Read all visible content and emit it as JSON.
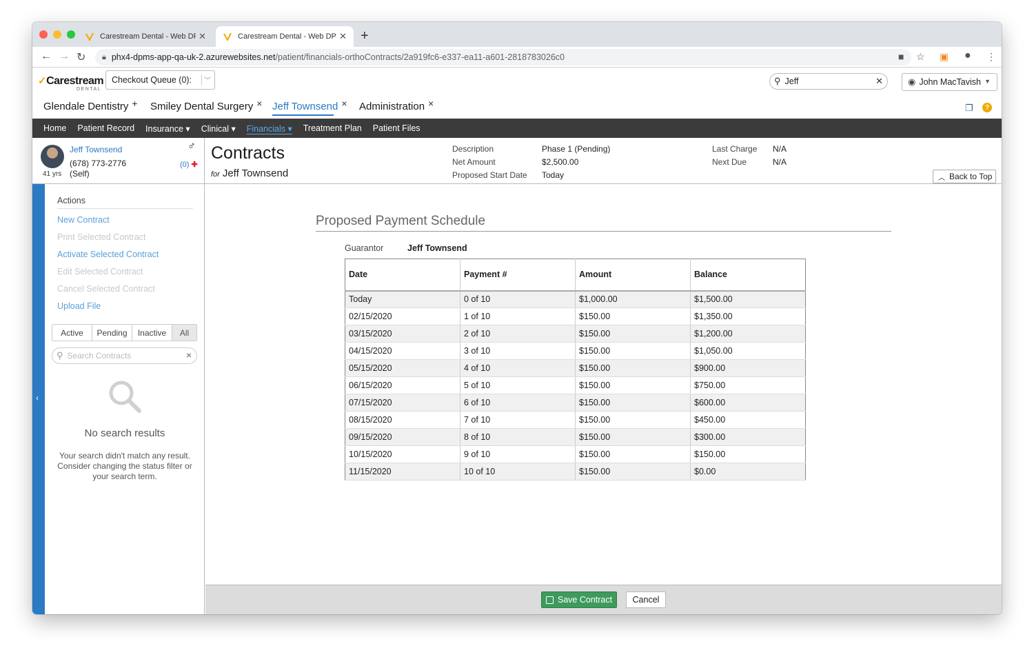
{
  "browser": {
    "tabs": [
      {
        "title": "Carestream Dental - Web DPMS"
      },
      {
        "title": "Carestream Dental - Web DPMS"
      }
    ],
    "url_host": "phx4-dpms-app-qa-uk-2.azurewebsites.net",
    "url_path": "/patient/financials-orthoContracts/2a919fc6-e337-ea11-a601-2818783026c0"
  },
  "header": {
    "logo": "Carestream",
    "logo_sub": "DENTAL",
    "checkout_queue": "Checkout Queue (0):",
    "search_value": "Jeff",
    "user_name": "John MacTavish"
  },
  "practice_tabs": [
    {
      "label": "Glendale Dentistry",
      "icon": "+"
    },
    {
      "label": "Smiley Dental Surgery",
      "icon": "×"
    },
    {
      "label": "Jeff Townsend",
      "icon": "×"
    },
    {
      "label": "Administration",
      "icon": "×"
    }
  ],
  "nav": {
    "items": [
      "Home",
      "Patient Record",
      "Insurance ▾",
      "Clinical ▾",
      "Financials ▾",
      "Treatment Plan",
      "Patient Files"
    ],
    "active_index": 4
  },
  "patient": {
    "name": "Jeff Townsend",
    "phone": "(678) 773-2776",
    "relation": "(Self)",
    "age": "41 yrs",
    "alerts": "(0)"
  },
  "contract_header": {
    "title": "Contracts",
    "for_label": "for",
    "for_name": "Jeff Townsend",
    "description_label": "Description",
    "description_value": "Phase 1 (Pending)",
    "net_amount_label": "Net Amount",
    "net_amount_value": "$2,500.00",
    "start_label": "Proposed Start Date",
    "start_value": "Today",
    "last_charge_label": "Last Charge",
    "last_charge_value": "N/A",
    "next_due_label": "Next Due",
    "next_due_value": "N/A",
    "back_to_top": "Back to Top"
  },
  "sidebar": {
    "actions_title": "Actions",
    "actions": [
      {
        "label": "New Contract",
        "enabled": true
      },
      {
        "label": "Print Selected Contract",
        "enabled": false
      },
      {
        "label": "Activate Selected Contract",
        "enabled": true
      },
      {
        "label": "Edit Selected Contract",
        "enabled": false
      },
      {
        "label": "Cancel Selected Contract",
        "enabled": false
      },
      {
        "label": "Upload File",
        "enabled": true
      }
    ],
    "filters": [
      "Active",
      "Pending",
      "Inactive",
      "All"
    ],
    "search_placeholder": "Search Contracts",
    "no_results_title": "No search results",
    "no_results_text": "Your search didn't match any result. Consider changing the status filter or your search term."
  },
  "schedule": {
    "title": "Proposed Payment Schedule",
    "guarantor_label": "Guarantor",
    "guarantor_value": "Jeff Townsend",
    "columns": [
      "Date",
      "Payment #",
      "Amount",
      "Balance"
    ],
    "rows": [
      [
        "Today",
        "0 of 10",
        "$1,000.00",
        "$1,500.00"
      ],
      [
        "02/15/2020",
        "1 of 10",
        "$150.00",
        "$1,350.00"
      ],
      [
        "03/15/2020",
        "2 of 10",
        "$150.00",
        "$1,200.00"
      ],
      [
        "04/15/2020",
        "3 of 10",
        "$150.00",
        "$1,050.00"
      ],
      [
        "05/15/2020",
        "4 of 10",
        "$150.00",
        "$900.00"
      ],
      [
        "06/15/2020",
        "5 of 10",
        "$150.00",
        "$750.00"
      ],
      [
        "07/15/2020",
        "6 of 10",
        "$150.00",
        "$600.00"
      ],
      [
        "08/15/2020",
        "7 of 10",
        "$150.00",
        "$450.00"
      ],
      [
        "09/15/2020",
        "8 of 10",
        "$150.00",
        "$300.00"
      ],
      [
        "10/15/2020",
        "9 of 10",
        "$150.00",
        "$150.00"
      ],
      [
        "11/15/2020",
        "10 of 10",
        "$150.00",
        "$0.00"
      ]
    ]
  },
  "footer": {
    "save_label": "Save Contract",
    "cancel_label": "Cancel"
  },
  "colors": {
    "accent": "#2b7ac3",
    "nav_bg": "#3b3b3b",
    "save_green": "#3d9b5c",
    "help": "#f2a900"
  }
}
